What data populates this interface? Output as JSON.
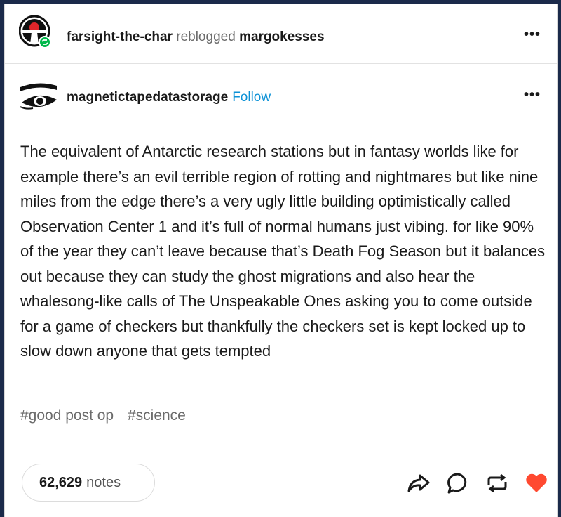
{
  "reblog_header": {
    "reblogger": "farsight-the-char",
    "action": "reblogged",
    "source": "margokesses",
    "avatar_icon": "keyhole-avatar-icon",
    "reblog_badge_icon": "reblog-badge-icon",
    "menu_icon": "meatball-menu-icon"
  },
  "post": {
    "author": "magnetictapedatastorage",
    "follow_label": "Follow",
    "avatar_icon": "eye-avatar-icon",
    "menu_icon": "meatball-menu-icon",
    "body": "The equivalent of Antarctic research stations but in fantasy worlds like for example there’s an evil terrible region of rotting and nightmares but like nine miles from the edge there’s a very ugly little building optimistically called Observation Center 1 and it’s full of normal humans just vibing. for like 90% of the year they can’t leave because that’s Death Fog Season but it balances out because they can study the ghost migrations and also hear the whalesong-like calls of The Unspeakable Ones asking you to come outside for a game of checkers but thankfully the checkers set is kept locked up to slow down anyone that gets tempted",
    "tags": [
      "#good post op",
      "#science"
    ]
  },
  "footer": {
    "notes_count": "62,629",
    "notes_label": "notes",
    "actions": [
      "share-icon",
      "reply-icon",
      "reblog-icon",
      "like-icon"
    ],
    "like_color": "#ff4930"
  },
  "colors": {
    "follow": "#0b91d6",
    "frame": "#1b2a4a",
    "reblog_badge": "#00b84a"
  }
}
